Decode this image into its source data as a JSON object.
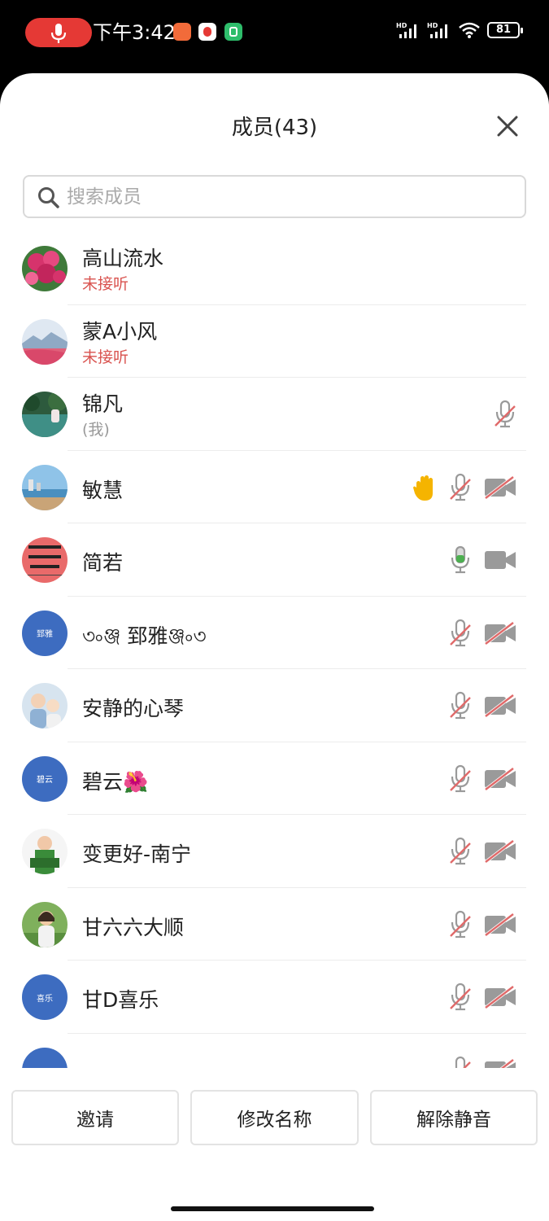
{
  "status_bar": {
    "time": "下午3:42",
    "battery": "81",
    "network_labels": [
      "HD",
      "HD"
    ],
    "icons": [
      "mic-recording-icon",
      "app-icon-orange",
      "app-icon-red",
      "app-icon-green",
      "signal-icon",
      "signal-icon",
      "wifi-icon",
      "battery-icon"
    ]
  },
  "header": {
    "title": "成员(43)",
    "close_icon": "close-icon"
  },
  "search": {
    "placeholder": "搜索成员",
    "value": ""
  },
  "members": [
    {
      "name": "高山流水",
      "status": "未接听",
      "status_type": "red",
      "avatar": "photo-flowers",
      "icons": []
    },
    {
      "name": "蒙A小风",
      "status": "未接听",
      "status_type": "red",
      "avatar": "photo-landscape",
      "icons": []
    },
    {
      "name": "锦凡",
      "status": "(我)",
      "status_type": "gray",
      "avatar": "photo-lake",
      "icons": [
        "mic-muted"
      ]
    },
    {
      "name": "敏慧",
      "status": "",
      "avatar": "photo-beach",
      "icons": [
        "hand",
        "mic-muted",
        "video-off"
      ]
    },
    {
      "name": "简若",
      "status": "",
      "avatar": "photo-red-card",
      "icons": [
        "mic-active",
        "video-on"
      ]
    },
    {
      "name": "৩৹ঞ্জ 郅雅ঞ্জ৹৩",
      "status": "",
      "avatar": "text",
      "avatar_text": "郅雅",
      "icons": [
        "mic-muted",
        "video-off"
      ]
    },
    {
      "name": "安静的心琴",
      "status": "",
      "avatar": "photo-children",
      "icons": [
        "mic-muted",
        "video-off"
      ]
    },
    {
      "name": "碧云🌺",
      "status": "",
      "avatar": "text",
      "avatar_text": "碧云",
      "icons": [
        "mic-muted",
        "video-off"
      ]
    },
    {
      "name": "变更好-南宁",
      "status": "",
      "avatar": "photo-portrait",
      "icons": [
        "mic-muted",
        "video-off"
      ]
    },
    {
      "name": "甘六六大顺",
      "status": "",
      "avatar": "photo-woman",
      "icons": [
        "mic-muted",
        "video-off"
      ]
    },
    {
      "name": "甘D喜乐",
      "status": "",
      "avatar": "text",
      "avatar_text": "喜乐",
      "icons": [
        "mic-muted",
        "video-off"
      ]
    },
    {
      "name": "",
      "status": "",
      "avatar": "text",
      "avatar_text": "",
      "icons": [
        "mic-muted",
        "video-off"
      ]
    }
  ],
  "actions": {
    "invite": "邀请",
    "rename": "修改名称",
    "unmute": "解除静音"
  },
  "colors": {
    "accent_red": "#d9534f",
    "mic_active_green": "#4caf50",
    "avatar_blue": "#3d6cc0",
    "icon_gray": "#9a9a9a"
  }
}
